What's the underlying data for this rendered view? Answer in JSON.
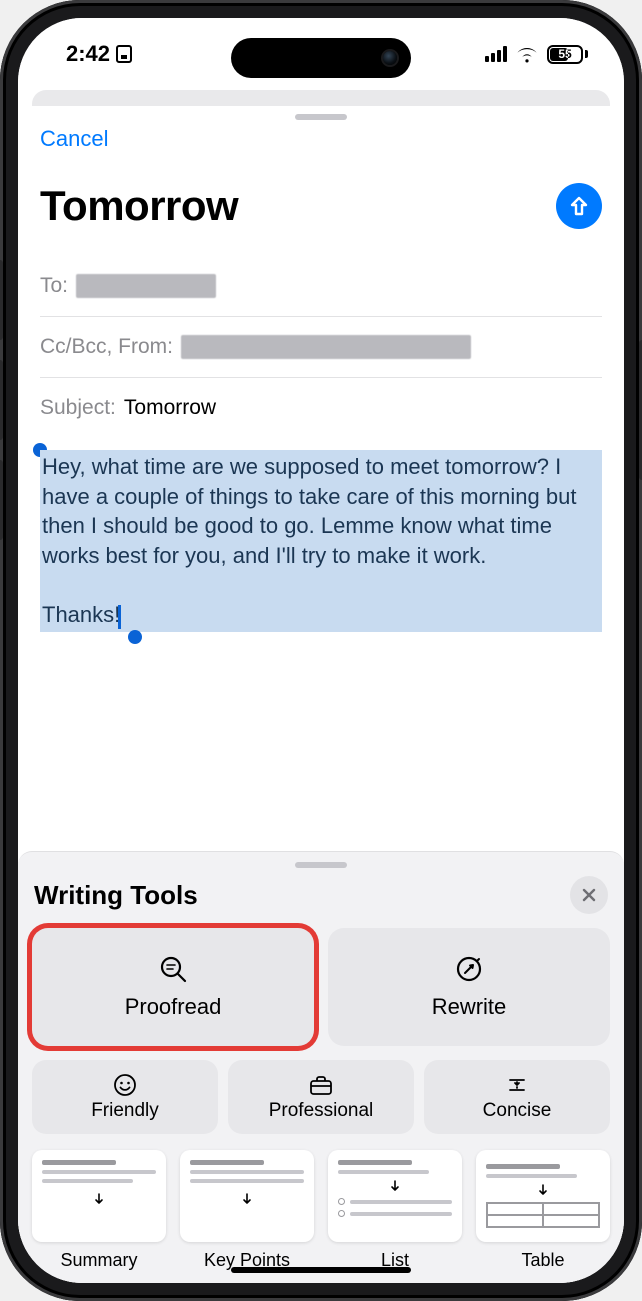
{
  "status": {
    "time": "2:42",
    "battery_pct": "55"
  },
  "nav": {
    "cancel": "Cancel"
  },
  "compose": {
    "title": "Tomorrow",
    "to_label": "To:",
    "cc_label": "Cc/Bcc, From:",
    "subject_label": "Subject:",
    "subject_value": "Tomorrow",
    "body_para1": "Hey, what time are we supposed to meet tomorrow? I have a couple of things to take care of this morning but then I should be good to go. Lemme know what time works best for you, and I'll try to make it work.",
    "body_para2": "Thanks!"
  },
  "wt": {
    "title": "Writing Tools",
    "proofread": "Proofread",
    "rewrite": "Rewrite",
    "friendly": "Friendly",
    "professional": "Professional",
    "concise": "Concise",
    "summary": "Summary",
    "keypoints": "Key Points",
    "list": "List",
    "table": "Table"
  },
  "colors": {
    "accent": "#007aff",
    "highlight": "#e33b36",
    "selection": "#c8dbf0"
  },
  "annotation": {
    "highlighted_tool": "proofread"
  }
}
